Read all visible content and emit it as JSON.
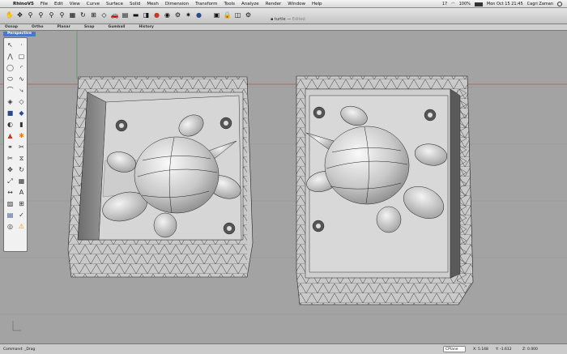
{
  "menubar": {
    "app_name": "RhinoV5",
    "items": [
      "File",
      "Edit",
      "View",
      "Curve",
      "Surface",
      "Solid",
      "Mesh",
      "Dimension",
      "Transform",
      "Tools",
      "Analyze",
      "Render",
      "Window",
      "Help"
    ],
    "battery": "100%",
    "clock": "Mon Oct 15  21:45",
    "user": "Cagri Zaman",
    "badge": "17"
  },
  "window": {
    "title": "turtle",
    "status": "Edited"
  },
  "tabs": [
    "Osnap",
    "Ortho",
    "Planar",
    "Snap",
    "Gumball",
    "History"
  ],
  "viewport": {
    "label": "Perspective"
  },
  "statusbar": {
    "command": "Command: _Drag",
    "cplane": "CPlane",
    "x": "X: 5.148",
    "y": "Y: -1.612",
    "z": "Z: 0.000"
  },
  "colors": {
    "viewport": "#a3a3a3",
    "mold": "#d9d9d9",
    "grid_red": "#b23b3b",
    "grid_green": "#3b9b3b",
    "label_blue": "#4a78c4"
  }
}
